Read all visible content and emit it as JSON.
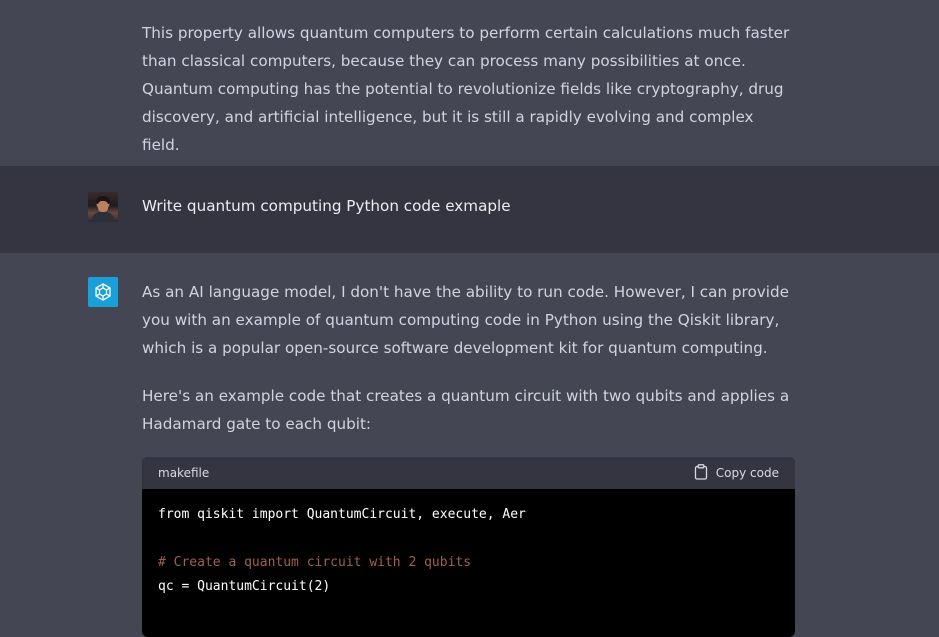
{
  "top_message": {
    "text": "This property allows quantum computers to perform certain calculations much faster than classical computers, because they can process many possibilities at once. Quantum computing has the potential to revolutionize fields like cryptography, drug discovery, and artificial intelligence, but it is still a rapidly evolving and complex field."
  },
  "user_message": {
    "text": "Write quantum computing Python code exmaple"
  },
  "ai_message": {
    "para1": "As an AI language model, I don't have the ability to run code. However, I can provide you with an example of quantum computing code in Python using the Qiskit library, which is a popular open-source software development kit for quantum computing.",
    "para2": "Here's an example code that creates a quantum circuit with two qubits and applies a Hadamard gate to each qubit:",
    "code": {
      "language": "makefile",
      "copy_label": "Copy code",
      "lines": [
        "from qiskit import QuantumCircuit, execute, Aer",
        "",
        "# Create a quantum circuit with 2 qubits",
        "qc = QuantumCircuit(2)"
      ]
    }
  },
  "colors": {
    "assistant_bg": "#444654",
    "user_bg": "#343541",
    "code_bg": "#000000",
    "code_header_bg": "#343541",
    "comment": "#a0604a",
    "ai_avatar_bg": "#19a0d8"
  },
  "icons": {
    "ai_avatar": "openai-logo-icon",
    "copy": "clipboard-icon"
  }
}
